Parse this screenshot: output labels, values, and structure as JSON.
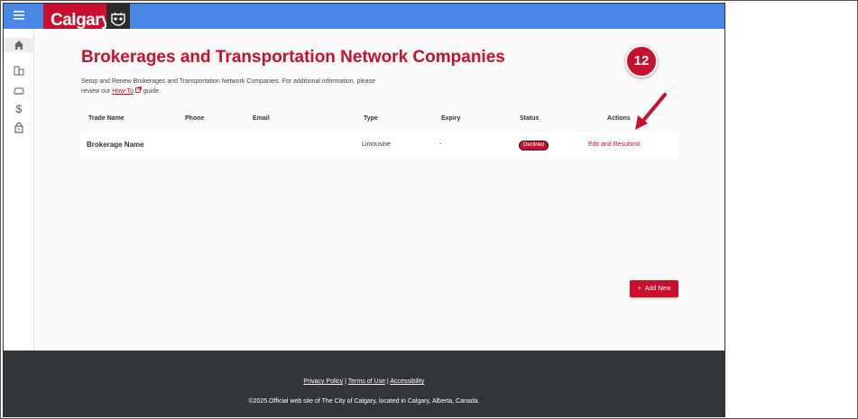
{
  "header": {
    "logo_text": "Calgary",
    "menu_icon": "hamburger-icon",
    "crest_icon": "city-crest-icon"
  },
  "sidebar": {
    "items": [
      {
        "icon": "home-icon"
      },
      {
        "icon": "building-icon"
      },
      {
        "icon": "vehicle-icon"
      },
      {
        "icon": "dollar-icon"
      },
      {
        "icon": "lock-icon"
      }
    ]
  },
  "page": {
    "title": "Brokerages and Transportation Network Companies",
    "intro_text": "Setup and Renew Brokerages and Transportation Network Companies. For additional information, please review our",
    "intro_link": "How-To",
    "intro_tail": "guide."
  },
  "table": {
    "headers": [
      "Trade Name",
      "Phone",
      "Email",
      "Type",
      "Expiry",
      "Status",
      "Actions"
    ],
    "rows": [
      {
        "trade_name": "Brokerage Name",
        "phone": "",
        "email": "",
        "type": "Limousine",
        "expiry": "-",
        "status": "Declined",
        "action": "Edit and Resubmit"
      }
    ]
  },
  "callout": {
    "number": "12"
  },
  "buttons": {
    "add_new": "Add New",
    "add_icon": "+"
  },
  "footer": {
    "links": [
      "Privacy Policy",
      "Terms of Use",
      "Accessibility"
    ],
    "separator": "|",
    "copyright": "©2025.Official web site of The City of Calgary, located in Calgary, Alberta, Canada."
  },
  "colors": {
    "brand_red": "#c8102e",
    "topbar_blue": "#4a86e8",
    "footer_dark": "#333638"
  }
}
